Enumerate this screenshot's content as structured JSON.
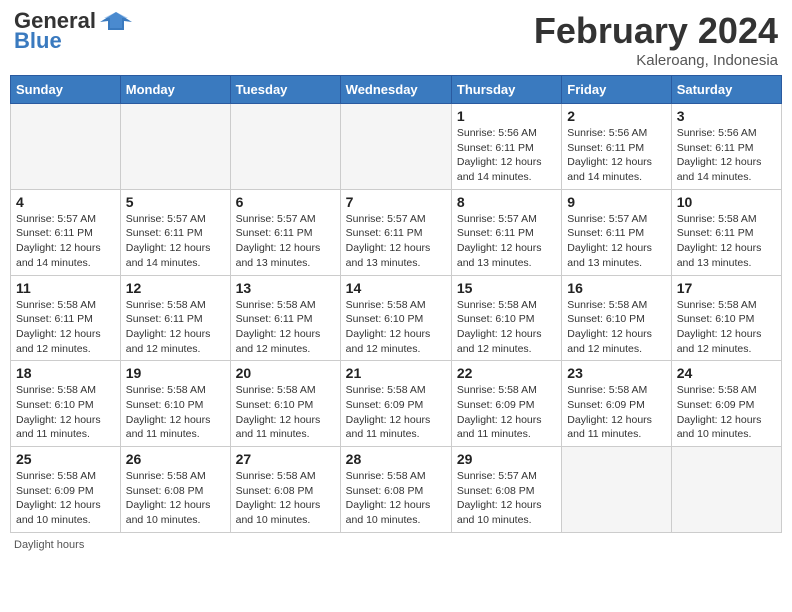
{
  "header": {
    "logo_line1": "General",
    "logo_line2": "Blue",
    "month": "February 2024",
    "location": "Kaleroang, Indonesia"
  },
  "days_of_week": [
    "Sunday",
    "Monday",
    "Tuesday",
    "Wednesday",
    "Thursday",
    "Friday",
    "Saturday"
  ],
  "weeks": [
    [
      {
        "day": "",
        "info": ""
      },
      {
        "day": "",
        "info": ""
      },
      {
        "day": "",
        "info": ""
      },
      {
        "day": "",
        "info": ""
      },
      {
        "day": "1",
        "info": "Sunrise: 5:56 AM\nSunset: 6:11 PM\nDaylight: 12 hours\nand 14 minutes."
      },
      {
        "day": "2",
        "info": "Sunrise: 5:56 AM\nSunset: 6:11 PM\nDaylight: 12 hours\nand 14 minutes."
      },
      {
        "day": "3",
        "info": "Sunrise: 5:56 AM\nSunset: 6:11 PM\nDaylight: 12 hours\nand 14 minutes."
      }
    ],
    [
      {
        "day": "4",
        "info": "Sunrise: 5:57 AM\nSunset: 6:11 PM\nDaylight: 12 hours\nand 14 minutes."
      },
      {
        "day": "5",
        "info": "Sunrise: 5:57 AM\nSunset: 6:11 PM\nDaylight: 12 hours\nand 14 minutes."
      },
      {
        "day": "6",
        "info": "Sunrise: 5:57 AM\nSunset: 6:11 PM\nDaylight: 12 hours\nand 13 minutes."
      },
      {
        "day": "7",
        "info": "Sunrise: 5:57 AM\nSunset: 6:11 PM\nDaylight: 12 hours\nand 13 minutes."
      },
      {
        "day": "8",
        "info": "Sunrise: 5:57 AM\nSunset: 6:11 PM\nDaylight: 12 hours\nand 13 minutes."
      },
      {
        "day": "9",
        "info": "Sunrise: 5:57 AM\nSunset: 6:11 PM\nDaylight: 12 hours\nand 13 minutes."
      },
      {
        "day": "10",
        "info": "Sunrise: 5:58 AM\nSunset: 6:11 PM\nDaylight: 12 hours\nand 13 minutes."
      }
    ],
    [
      {
        "day": "11",
        "info": "Sunrise: 5:58 AM\nSunset: 6:11 PM\nDaylight: 12 hours\nand 12 minutes."
      },
      {
        "day": "12",
        "info": "Sunrise: 5:58 AM\nSunset: 6:11 PM\nDaylight: 12 hours\nand 12 minutes."
      },
      {
        "day": "13",
        "info": "Sunrise: 5:58 AM\nSunset: 6:11 PM\nDaylight: 12 hours\nand 12 minutes."
      },
      {
        "day": "14",
        "info": "Sunrise: 5:58 AM\nSunset: 6:10 PM\nDaylight: 12 hours\nand 12 minutes."
      },
      {
        "day": "15",
        "info": "Sunrise: 5:58 AM\nSunset: 6:10 PM\nDaylight: 12 hours\nand 12 minutes."
      },
      {
        "day": "16",
        "info": "Sunrise: 5:58 AM\nSunset: 6:10 PM\nDaylight: 12 hours\nand 12 minutes."
      },
      {
        "day": "17",
        "info": "Sunrise: 5:58 AM\nSunset: 6:10 PM\nDaylight: 12 hours\nand 12 minutes."
      }
    ],
    [
      {
        "day": "18",
        "info": "Sunrise: 5:58 AM\nSunset: 6:10 PM\nDaylight: 12 hours\nand 11 minutes."
      },
      {
        "day": "19",
        "info": "Sunrise: 5:58 AM\nSunset: 6:10 PM\nDaylight: 12 hours\nand 11 minutes."
      },
      {
        "day": "20",
        "info": "Sunrise: 5:58 AM\nSunset: 6:10 PM\nDaylight: 12 hours\nand 11 minutes."
      },
      {
        "day": "21",
        "info": "Sunrise: 5:58 AM\nSunset: 6:09 PM\nDaylight: 12 hours\nand 11 minutes."
      },
      {
        "day": "22",
        "info": "Sunrise: 5:58 AM\nSunset: 6:09 PM\nDaylight: 12 hours\nand 11 minutes."
      },
      {
        "day": "23",
        "info": "Sunrise: 5:58 AM\nSunset: 6:09 PM\nDaylight: 12 hours\nand 11 minutes."
      },
      {
        "day": "24",
        "info": "Sunrise: 5:58 AM\nSunset: 6:09 PM\nDaylight: 12 hours\nand 10 minutes."
      }
    ],
    [
      {
        "day": "25",
        "info": "Sunrise: 5:58 AM\nSunset: 6:09 PM\nDaylight: 12 hours\nand 10 minutes."
      },
      {
        "day": "26",
        "info": "Sunrise: 5:58 AM\nSunset: 6:08 PM\nDaylight: 12 hours\nand 10 minutes."
      },
      {
        "day": "27",
        "info": "Sunrise: 5:58 AM\nSunset: 6:08 PM\nDaylight: 12 hours\nand 10 minutes."
      },
      {
        "day": "28",
        "info": "Sunrise: 5:58 AM\nSunset: 6:08 PM\nDaylight: 12 hours\nand 10 minutes."
      },
      {
        "day": "29",
        "info": "Sunrise: 5:57 AM\nSunset: 6:08 PM\nDaylight: 12 hours\nand 10 minutes."
      },
      {
        "day": "",
        "info": ""
      },
      {
        "day": "",
        "info": ""
      }
    ]
  ],
  "footer": {
    "daylight_label": "Daylight hours"
  }
}
